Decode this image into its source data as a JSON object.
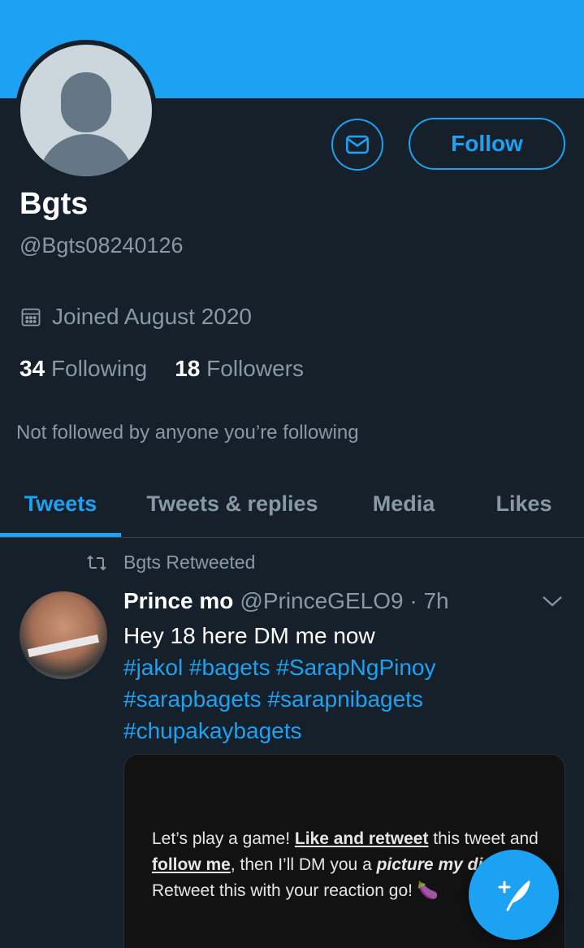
{
  "profile": {
    "name": "Bgts",
    "handle": "@Bgts08240126",
    "joined": "Joined August 2020",
    "following_count": "34",
    "following_label": "Following",
    "followers_count": "18",
    "followers_label": "Followers",
    "not_followed": "Not followed by anyone you’re following"
  },
  "actions": {
    "follow_label": "Follow",
    "message_icon": "envelope-icon"
  },
  "tabs": [
    {
      "label": "Tweets",
      "active": true
    },
    {
      "label": "Tweets & replies",
      "active": false
    },
    {
      "label": "Media",
      "active": false
    },
    {
      "label": "Likes",
      "active": false
    }
  ],
  "tweet": {
    "retweeted_by": "Bgts Retweeted",
    "author_name": "Prince mo",
    "author_handle": "@PrinceGELO9 · 7h",
    "text": "Hey 18 here DM me now",
    "hashtags_line1": "#jakol #bagets #SarapNgPinoy",
    "hashtags_line2": "#sarapbagets #sarapnibagets",
    "hashtags_line3": "#chupakaybagets",
    "media_text": {
      "p1": "Let’s play a game! ",
      "like_retweet": "Like and retweet",
      "p2": " this tweet and ",
      "follow_me": "follow me",
      "p3": ", then I’ll DM you a ",
      "picture": "picture",
      "p4": " ",
      "my_dick": "my dick",
      "p5": ". Retweet this with your reaction",
      "p6": " go! 🍆"
    }
  },
  "colors": {
    "accent": "#1da1f2",
    "background": "#15202b",
    "secondary_text": "#8899a6"
  }
}
